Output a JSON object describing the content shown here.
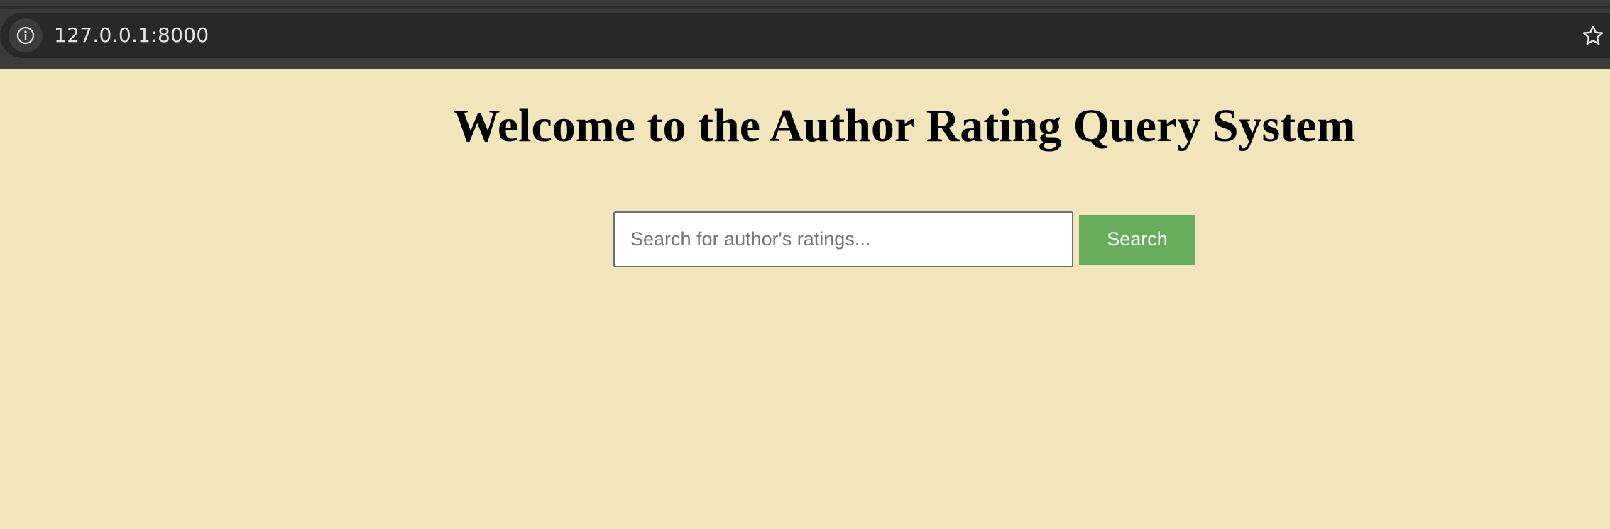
{
  "browser": {
    "url": "127.0.0.1:8000",
    "site_info_icon": "info-circle-icon",
    "bookmark_icon": "star-outline-icon"
  },
  "page": {
    "title": "Welcome to the Author Rating Query System",
    "background_color": "#f1e6bb"
  },
  "search": {
    "value": "",
    "placeholder": "Search for author's ratings...",
    "button_label": "Search",
    "button_color": "#67ad5b"
  }
}
